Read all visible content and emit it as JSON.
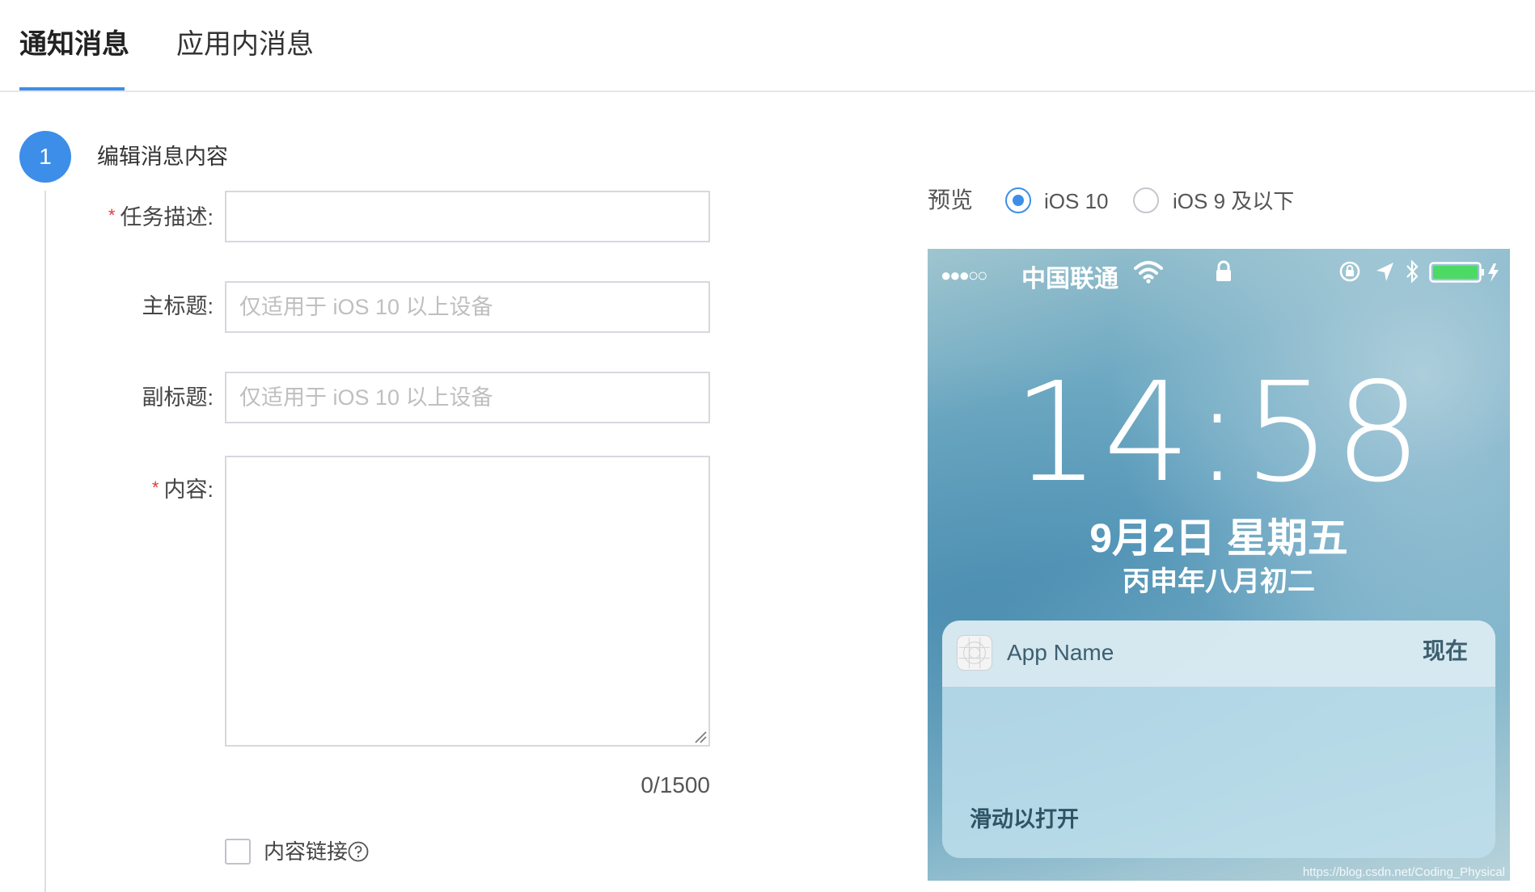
{
  "tabs": [
    {
      "label": "通知消息",
      "active": true
    },
    {
      "label": "应用内消息",
      "active": false
    }
  ],
  "step": {
    "number": "1",
    "title": "编辑消息内容"
  },
  "form": {
    "required_mark": "*",
    "task_description": {
      "label": "任务描述:",
      "value": "",
      "required": true
    },
    "main_title": {
      "label": "主标题:",
      "placeholder": "仅适用于 iOS 10 以上设备",
      "value": ""
    },
    "subtitle": {
      "label": "副标题:",
      "placeholder": "仅适用于 iOS 10 以上设备",
      "value": ""
    },
    "content": {
      "label": "内容:",
      "value": "",
      "required": true
    },
    "counter": "0/1500",
    "content_link": {
      "label": "内容链接",
      "checked": false
    }
  },
  "preview": {
    "label": "预览",
    "options": [
      {
        "label": "iOS 10",
        "selected": true
      },
      {
        "label": "iOS 9 及以下",
        "selected": false
      }
    ],
    "phone": {
      "signal": "●●●○○",
      "carrier": "中国联通",
      "time": "14:58",
      "date": "9月2日 星期五",
      "lunar": "丙申年八月初二",
      "notification": {
        "app_name": "App Name",
        "time": "现在",
        "slide_text": "滑动以打开"
      },
      "watermark": "https://blog.csdn.net/Coding_Physical"
    }
  },
  "colors": {
    "accent": "#3d8ee8",
    "required": "#e4393c",
    "border": "#d5d8de"
  }
}
